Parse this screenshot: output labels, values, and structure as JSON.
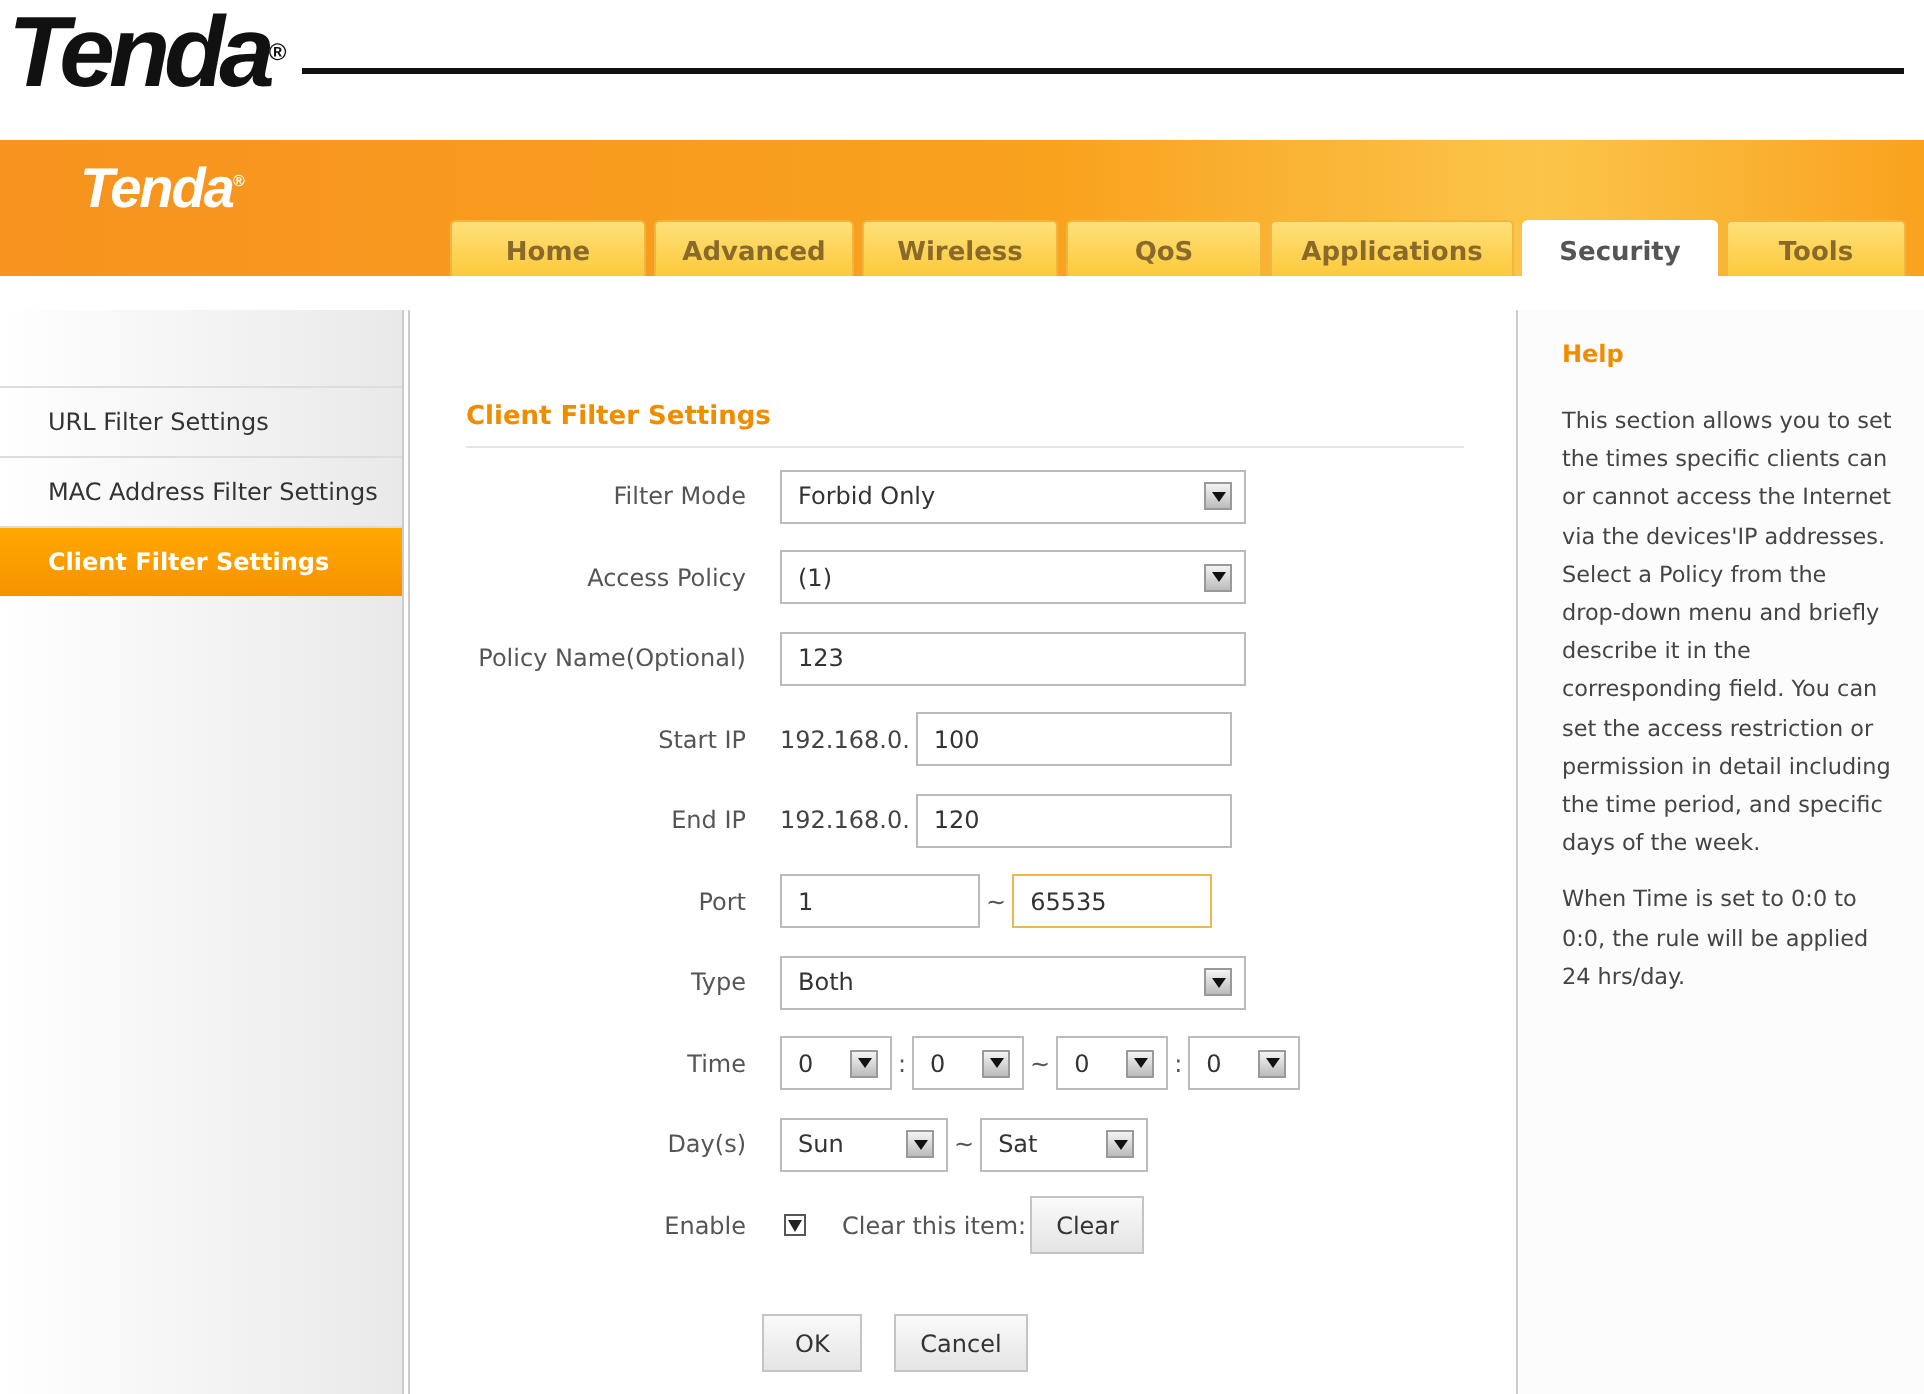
{
  "document_header": {
    "logo": "Tenda$^{®}$"
  },
  "router_header": {
    "logo": "Tenda$^{®}$"
  },
  "tabs": [
    {
      "label": "Home",
      "selected": false
    },
    {
      "label": "Advanced",
      "selected": false
    },
    {
      "label": "Wireless",
      "selected": false
    },
    {
      "label": "QoS",
      "selected": false
    },
    {
      "label": "Applications",
      "selected": false
    },
    {
      "label": "Security",
      "selected": true
    },
    {
      "label": "Tools",
      "selected": false
    }
  ],
  "sidebar": {
    "items": [
      {
        "label": "URL Filter Settings",
        "selected": false
      },
      {
        "label": "MAC Address Filter Settings",
        "selected": false
      },
      {
        "label": "Client Filter Settings",
        "selected": true
      }
    ]
  },
  "form": {
    "title": "Client Filter Settings",
    "fields": [
      {
        "kind": "select",
        "label": "Filter Mode",
        "value": "Forbid Only"
      },
      {
        "kind": "select",
        "label": "Access Policy",
        "value": "(1)"
      },
      {
        "kind": "text",
        "label": "Policy Name(Optional)",
        "value": "123"
      },
      {
        "kind": "ip",
        "label": "Start IP",
        "prefix": "192.168.0.",
        "value": "100"
      },
      {
        "kind": "ip",
        "label": "End IP",
        "prefix": "192.168.0.",
        "value": "120"
      },
      {
        "kind": "range",
        "label": "Port",
        "parts": [
          {
            "value": "1",
            "focused": false
          },
          {
            "separator": "~",
            "value": "65535",
            "focused": true
          }
        ]
      },
      {
        "kind": "select",
        "label": "Type",
        "value": "Both"
      },
      {
        "kind": "time",
        "label": "Time",
        "parts": [
          {
            "value": "0"
          },
          {
            "separator": ":",
            "value": "0"
          },
          {
            "separator": "~",
            "value": "0"
          },
          {
            "separator": ":",
            "value": "0"
          }
        ]
      },
      {
        "kind": "days",
        "label": "Day(s)",
        "parts": [
          {
            "value": "Sun"
          },
          {
            "separator": "~",
            "value": "Sat"
          }
        ]
      },
      {
        "kind": "enable",
        "label": "Enable",
        "checked": true,
        "clear_label": "Clear this item:",
        "clear_button": "Clear"
      }
    ],
    "buttons": [
      "OK",
      "Cancel"
    ]
  },
  "help": {
    "title": "Help",
    "paragraphs": [
      "This section allows you to set the times specific clients can or cannot access the Internet via the devices'IP addresses. Select a Policy from the drop-down menu and briefly describe it in the corresponding field. You can set the access restriction or permission in detail including the time period, and specific days of the week.",
      "When Time is set to 0:0 to 0:0, the rule will be applied 24 hrs/day."
    ]
  }
}
